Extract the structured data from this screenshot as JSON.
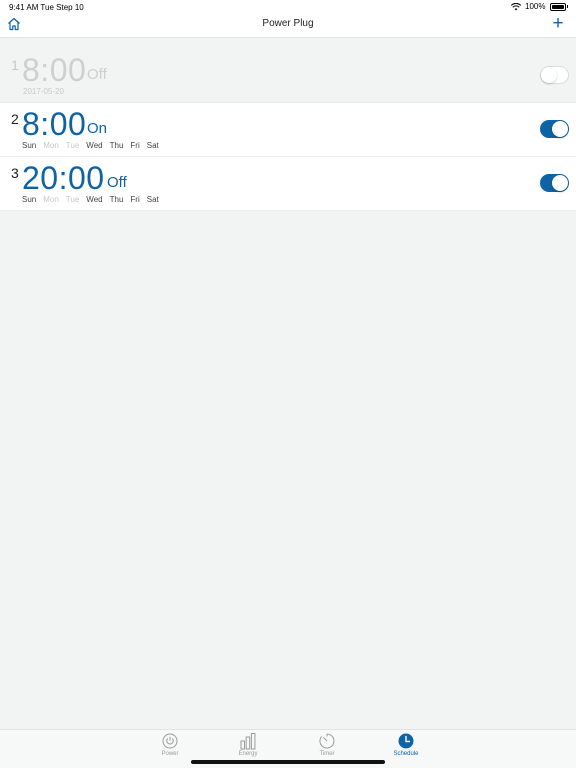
{
  "status_bar": {
    "time_date": "9:41 AM Tue Step 10",
    "battery": "100%"
  },
  "nav": {
    "title": "Power Plug",
    "home_icon": "home-icon",
    "add_icon": "plus-icon",
    "add_label": "+"
  },
  "schedules": [
    {
      "index": "1",
      "time": "8:00",
      "action": "Off",
      "date": "2017-05-20",
      "enabled": false
    },
    {
      "index": "2",
      "time": "8:00",
      "action": "On",
      "days": [
        "Sun",
        "Mon",
        "Tue",
        "Wed",
        "Thu",
        "Fri",
        "Sat"
      ],
      "active_days": [
        "Sun",
        "Wed",
        "Thu",
        "Fri",
        "Sat"
      ],
      "enabled": true
    },
    {
      "index": "3",
      "time": "20:00",
      "action": "Off",
      "days": [
        "Sun",
        "Mon",
        "Tue",
        "Wed",
        "Thu",
        "Fri",
        "Sat"
      ],
      "active_days": [
        "Sun",
        "Wed",
        "Thu",
        "Fri",
        "Sat"
      ],
      "enabled": true
    }
  ],
  "tabs": [
    {
      "label": "Power",
      "icon": "power-icon",
      "active": false
    },
    {
      "label": "Energy",
      "icon": "bar-chart-icon",
      "active": false
    },
    {
      "label": "Timer",
      "icon": "timer-icon",
      "active": false
    },
    {
      "label": "Schedule",
      "icon": "clock-icon",
      "active": true
    }
  ],
  "colors": {
    "accent": "#0d63a5",
    "inactive_text": "#c7c9c9",
    "background": "#f2f3f3"
  }
}
